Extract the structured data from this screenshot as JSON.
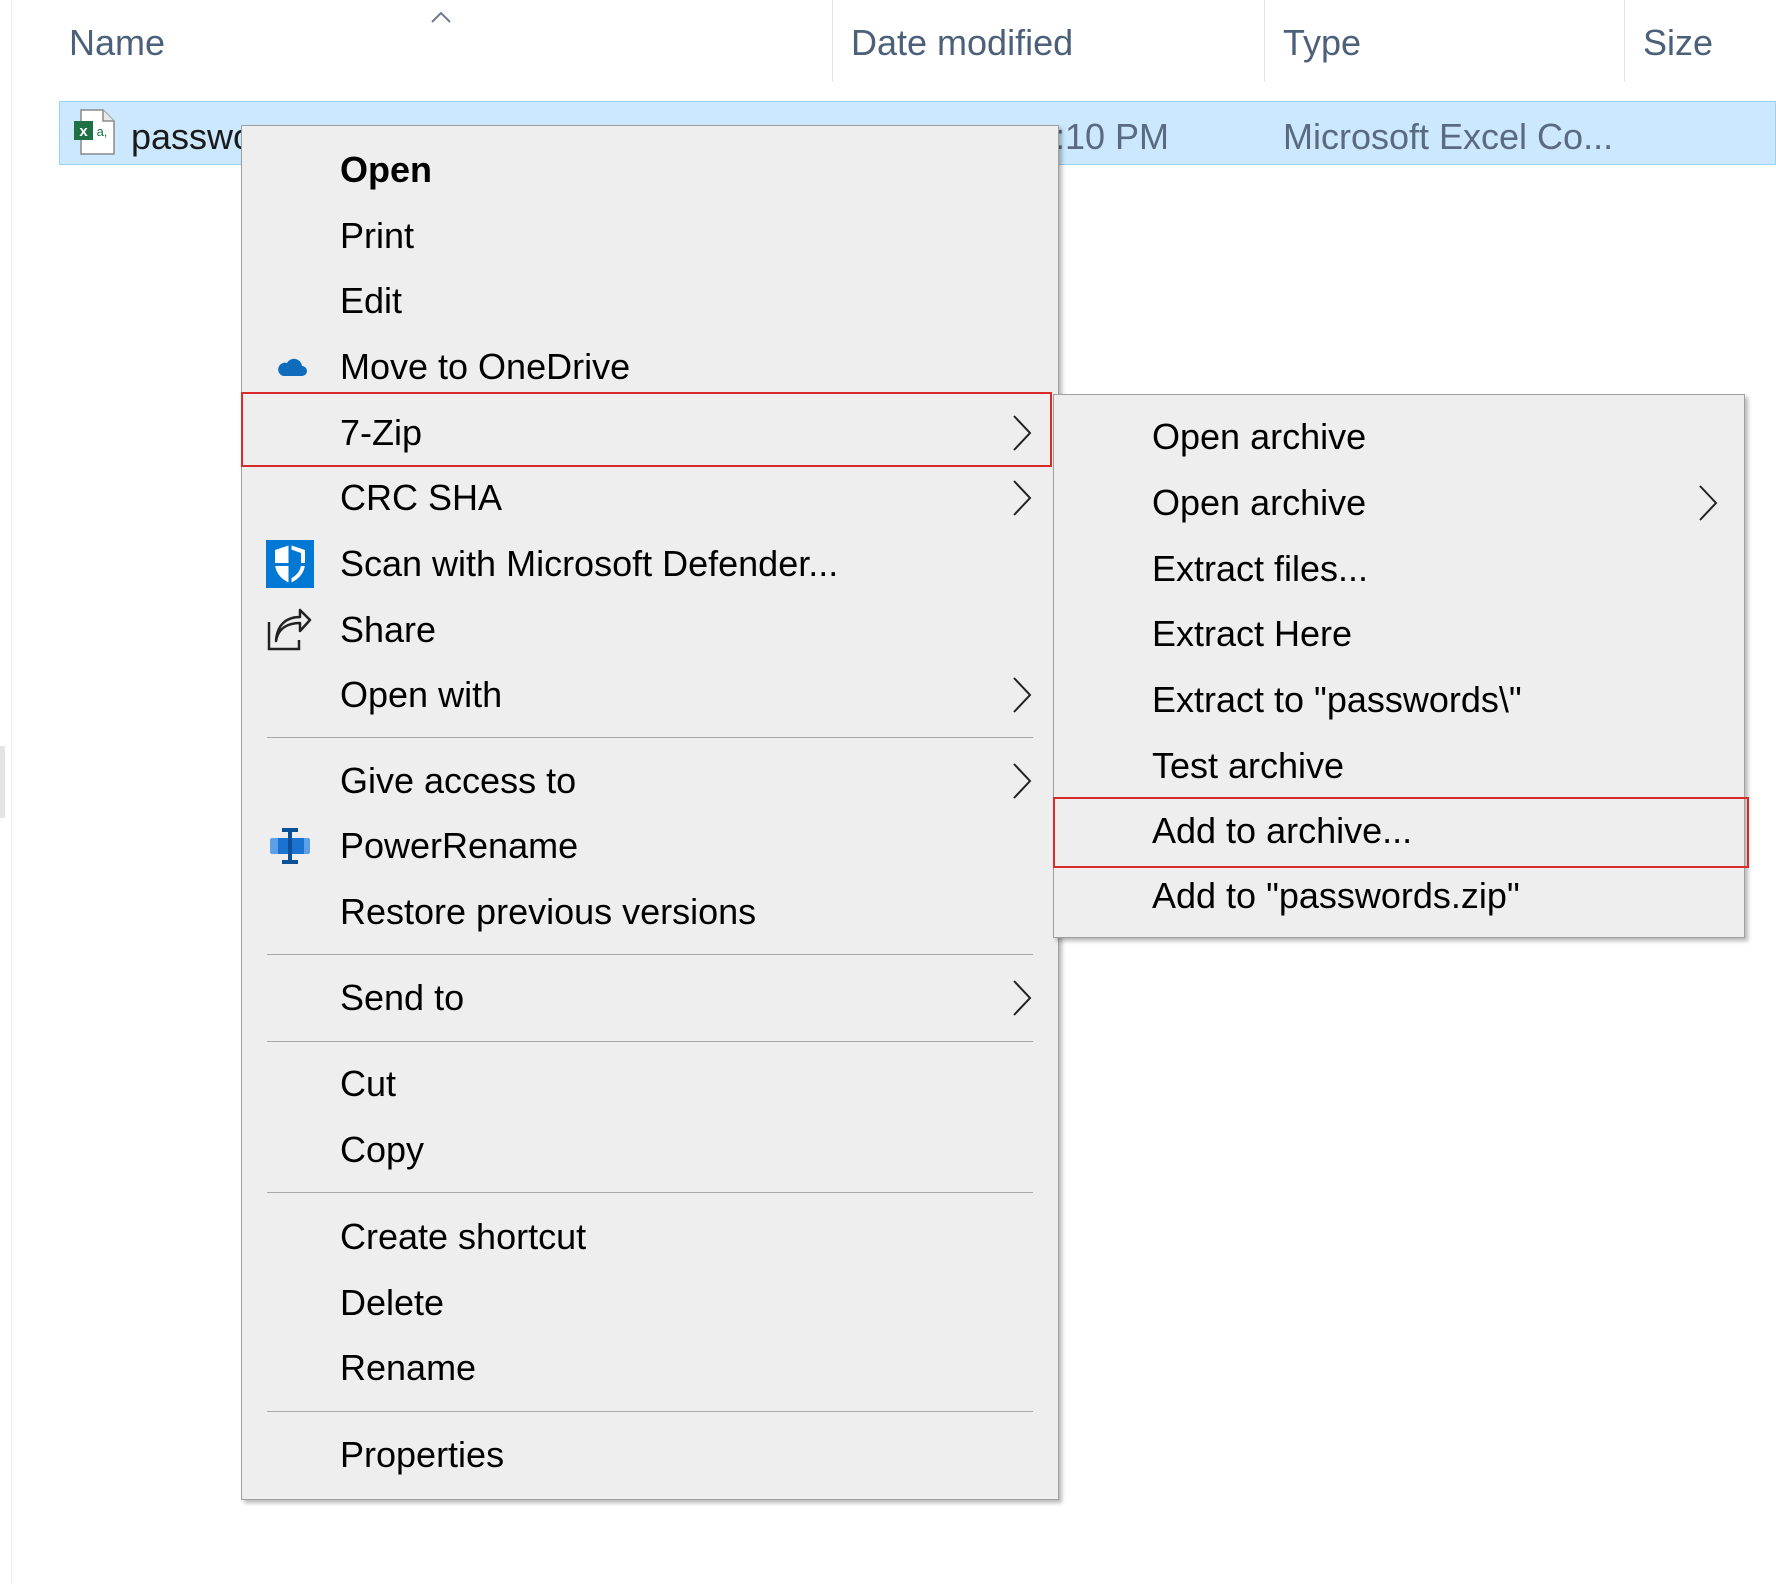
{
  "columns": {
    "name": "Name",
    "date_modified": "Date modified",
    "type": "Type",
    "size": "Size"
  },
  "file": {
    "name": "passwo",
    "date_modified": ":10 PM",
    "type": "Microsoft Excel Co..."
  },
  "context_menu": {
    "open": "Open",
    "print": "Print",
    "edit": "Edit",
    "move_to_onedrive": "Move to OneDrive",
    "seven_zip": "7-Zip",
    "crc_sha": "CRC SHA",
    "scan_defender": "Scan with Microsoft Defender...",
    "share": "Share",
    "open_with": "Open with",
    "give_access": "Give access to",
    "power_rename": "PowerRename",
    "restore_versions": "Restore previous versions",
    "send_to": "Send to",
    "cut": "Cut",
    "copy": "Copy",
    "create_shortcut": "Create shortcut",
    "delete": "Delete",
    "rename": "Rename",
    "properties": "Properties"
  },
  "seven_zip_menu": {
    "open_archive": "Open archive",
    "open_archive_sub": "Open archive",
    "extract_files": "Extract files...",
    "extract_here": "Extract Here",
    "extract_to": "Extract to \"passwords\\\"",
    "test_archive": "Test archive",
    "add_to_archive": "Add to archive...",
    "add_to_zip": "Add to \"passwords.zip\""
  },
  "icons": {
    "sort": "sort-ascending-caret-icon",
    "file": "excel-file-icon",
    "onedrive": "onedrive-cloud-icon",
    "defender": "defender-shield-icon",
    "share": "share-icon",
    "powerrename": "powerrename-icon",
    "submenu": "chevron-right-icon"
  },
  "colors": {
    "menu_bg": "#eeeeee",
    "selection_bg": "#cce8ff",
    "highlight_border": "#d92b2b",
    "onedrive": "#0f6cbd",
    "defender": "#0078d4",
    "excel": "#1e7145"
  }
}
